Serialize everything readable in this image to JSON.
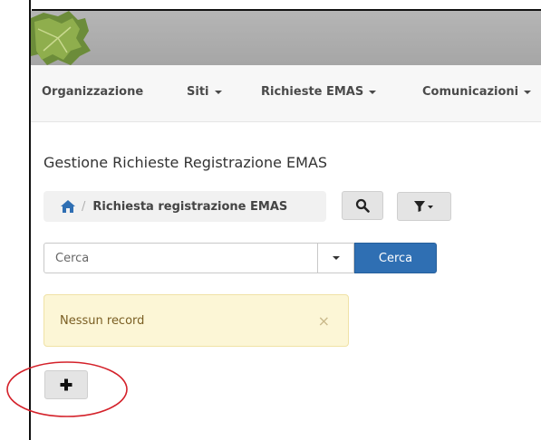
{
  "nav": {
    "items": [
      {
        "label": "Organizzazione",
        "has_caret": false
      },
      {
        "label": "Siti",
        "has_caret": true
      },
      {
        "label": "Richieste EMAS",
        "has_caret": true
      },
      {
        "label": "Comunicazioni",
        "has_caret": true
      }
    ]
  },
  "page": {
    "title": "Gestione Richieste Registrazione EMAS"
  },
  "breadcrumb": {
    "separator": "/",
    "label": "Richiesta registrazione EMAS"
  },
  "search": {
    "placeholder": "Cerca",
    "button_label": "Cerca"
  },
  "alert": {
    "message": "Nessun record",
    "close_symbol": "×"
  },
  "icons": {
    "home": "home-icon",
    "search": "search-icon",
    "filter": "filter-icon",
    "add": "plus-icon"
  },
  "colors": {
    "primary": "#2f6fb3",
    "alert_bg": "#fcf6d6",
    "highlight": "#d4212a"
  }
}
